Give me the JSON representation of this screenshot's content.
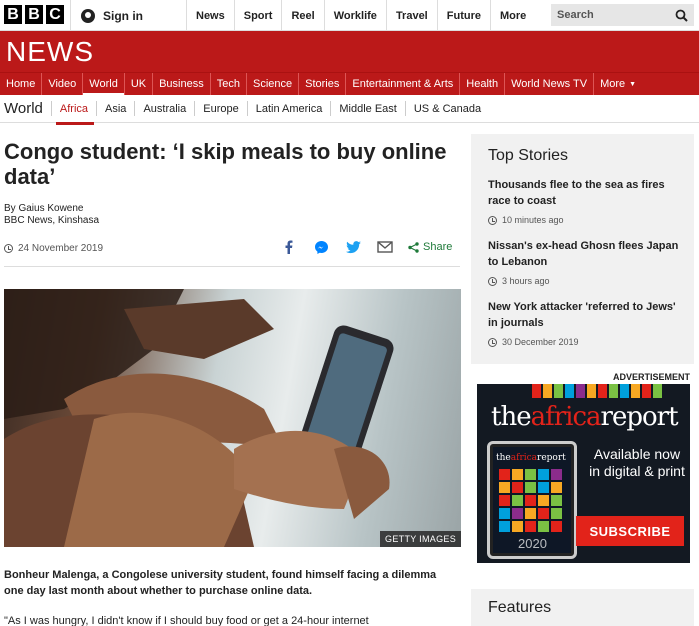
{
  "topbar": {
    "logo_letters": [
      "B",
      "B",
      "C"
    ],
    "sign_in": "Sign in",
    "nav": [
      "News",
      "Sport",
      "Reel",
      "Worklife",
      "Travel",
      "Future"
    ],
    "more": "More",
    "search_placeholder": "Search"
  },
  "banner": {
    "title": "NEWS"
  },
  "rednav": {
    "items": [
      "Home",
      "Video",
      "World",
      "UK",
      "Business",
      "Tech",
      "Science",
      "Stories",
      "Entertainment & Arts",
      "Health",
      "World News TV"
    ],
    "more": "More",
    "active": "World"
  },
  "worldnav": {
    "title": "World",
    "items": [
      "Africa",
      "Asia",
      "Australia",
      "Europe",
      "Latin America",
      "Middle East",
      "US & Canada"
    ],
    "active": "Africa"
  },
  "article": {
    "headline": "Congo student: ‘I skip meals to buy online data’",
    "author": "By Gaius Kowene",
    "outlet": "BBC News, Kinshasa",
    "date": "24 November 2019",
    "share_label": "Share",
    "image_caption": "GETTY IMAGES",
    "intro": "Bonheur Malenga, a Congolese university student, found himself facing a dilemma one day last month about whether to purchase online data.",
    "para2": "\"As I was hungry, I didn't know if I should buy food or get a 24-hour internet"
  },
  "top_stories": {
    "title": "Top Stories",
    "items": [
      {
        "title": "Thousands flee to the sea as fires race to coast",
        "time": "10 minutes ago"
      },
      {
        "title": "Nissan's ex-head Ghosn flees Japan to Lebanon",
        "time": "3 hours ago"
      },
      {
        "title": "New York attacker 'referred to Jews' in journals",
        "time": "30 December 2019"
      }
    ]
  },
  "advert": {
    "label": "ADVERTISEMENT",
    "brand_pre": "the",
    "brand_red": "africa",
    "brand_post": "report",
    "tagline": "Available now in digital & print",
    "year": "2020",
    "subscribe": "SUBSCRIBE",
    "stripe_colors": [
      "#e2231a",
      "#f7a823",
      "#7ac143",
      "#00a0dc",
      "#8b2c8c",
      "#f7a823",
      "#e2231a",
      "#7ac143",
      "#00a0dc",
      "#f7a823",
      "#e2231a",
      "#7ac143"
    ]
  },
  "features": {
    "title": "Features"
  },
  "colors": {
    "bbc_red": "#bb1919",
    "share_green": "#1f7a3a",
    "facebook": "#3b5998",
    "messenger": "#0084ff",
    "twitter": "#1da1f2"
  }
}
